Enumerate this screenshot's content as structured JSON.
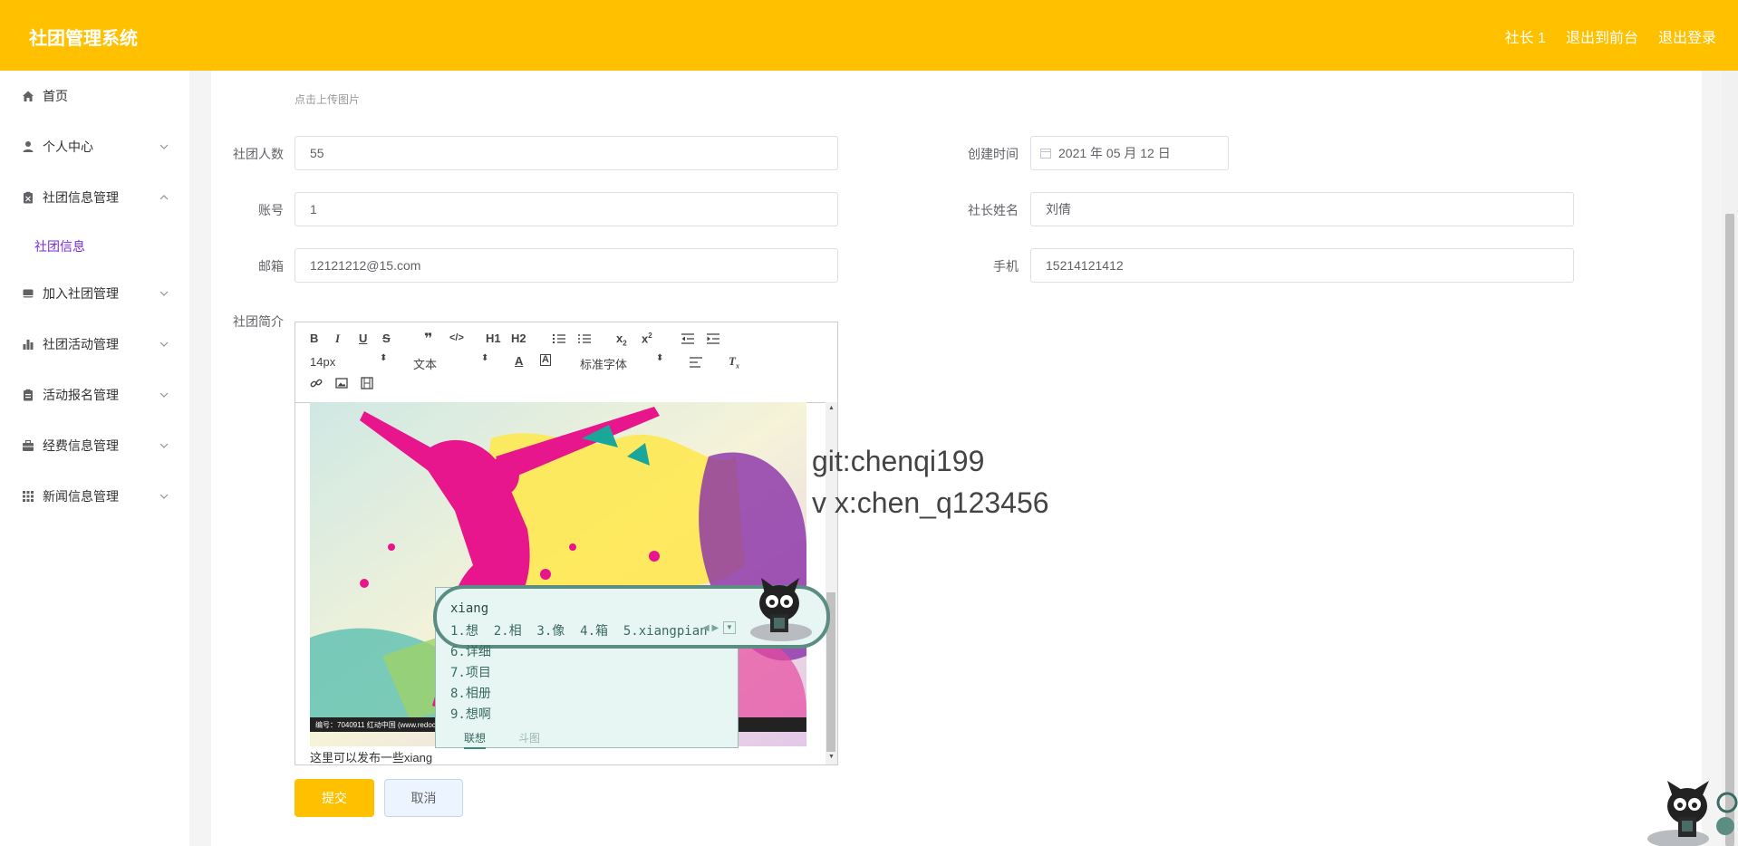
{
  "app": {
    "title": "社团管理系统"
  },
  "topnav": {
    "user": "社长 1",
    "front": "退出到前台",
    "logout": "退出登录"
  },
  "sidebar": {
    "items": [
      {
        "label": "首页",
        "icon": "home-icon"
      },
      {
        "label": "个人中心",
        "icon": "user-icon"
      },
      {
        "label": "社团信息管理",
        "icon": "clipboard-icon"
      },
      {
        "label": "加入社团管理",
        "icon": "box-icon"
      },
      {
        "label": "社团活动管理",
        "icon": "bar-chart-icon"
      },
      {
        "label": "活动报名管理",
        "icon": "clipboard-icon"
      },
      {
        "label": "经费信息管理",
        "icon": "briefcase-icon"
      },
      {
        "label": "新闻信息管理",
        "icon": "grid-icon"
      }
    ],
    "subitem": "社团信息"
  },
  "form": {
    "upload_hint": "点击上传图片",
    "member_count": {
      "label": "社团人数",
      "value": "55"
    },
    "created": {
      "label": "创建时间",
      "value": "2021 年 05 月 12 日"
    },
    "account": {
      "label": "账号",
      "value": "1"
    },
    "leader": {
      "label": "社长姓名",
      "value": "刘倩"
    },
    "email": {
      "label": "邮箱",
      "value": "12121212@15.com"
    },
    "phone": {
      "label": "手机",
      "value": "15214121412"
    },
    "intro": {
      "label": "社团简介"
    }
  },
  "editor": {
    "font_size": "14px",
    "block": "文本",
    "font_family": "标准字体",
    "h1": "H1",
    "h2": "H2",
    "image_caption": "编号：7040911   红动中国 (www.redoc",
    "content": "这里可以发布一些xiang"
  },
  "buttons": {
    "submit": "提交",
    "cancel": "取消"
  },
  "watermark": {
    "line1": "git:chenqi199",
    "line2": "v x:chen_q123456"
  },
  "ime": {
    "composition": "xiang",
    "candidates": "1.想  2.相  3.像  4.箱  5.xiangpian",
    "list": [
      "6.详细",
      "7.项目",
      "8.相册",
      "9.想啊"
    ],
    "tab1": "联想",
    "tab2": "斗图"
  },
  "colors": {
    "accent": "#ffc000",
    "active": "#7b2bdb"
  }
}
